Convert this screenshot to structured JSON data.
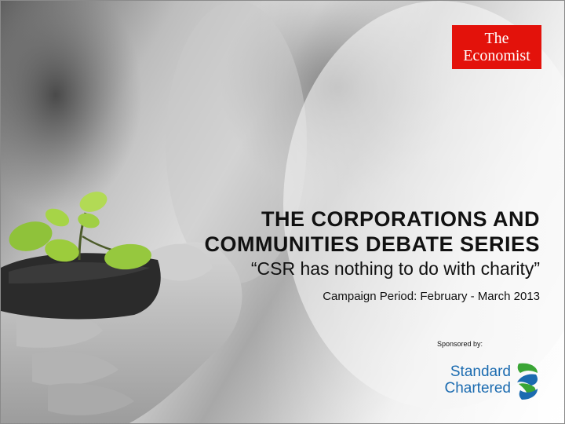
{
  "logo": {
    "line1": "The",
    "line2": "Economist",
    "color": "#e3120b"
  },
  "title": {
    "line1": "THE CORPORATIONS AND",
    "line2": "COMMUNITIES DEBATE SERIES",
    "subtitle": "“CSR has nothing to do with charity”"
  },
  "campaign": "Campaign Period: February - March 2013",
  "sponsor": {
    "label": "Sponsored by:",
    "name_line1": "Standard",
    "name_line2": "Chartered",
    "blue": "#1b6bb0",
    "green": "#3aa535"
  },
  "background": {
    "description_icon": "hands-holding-seedling-photo"
  }
}
